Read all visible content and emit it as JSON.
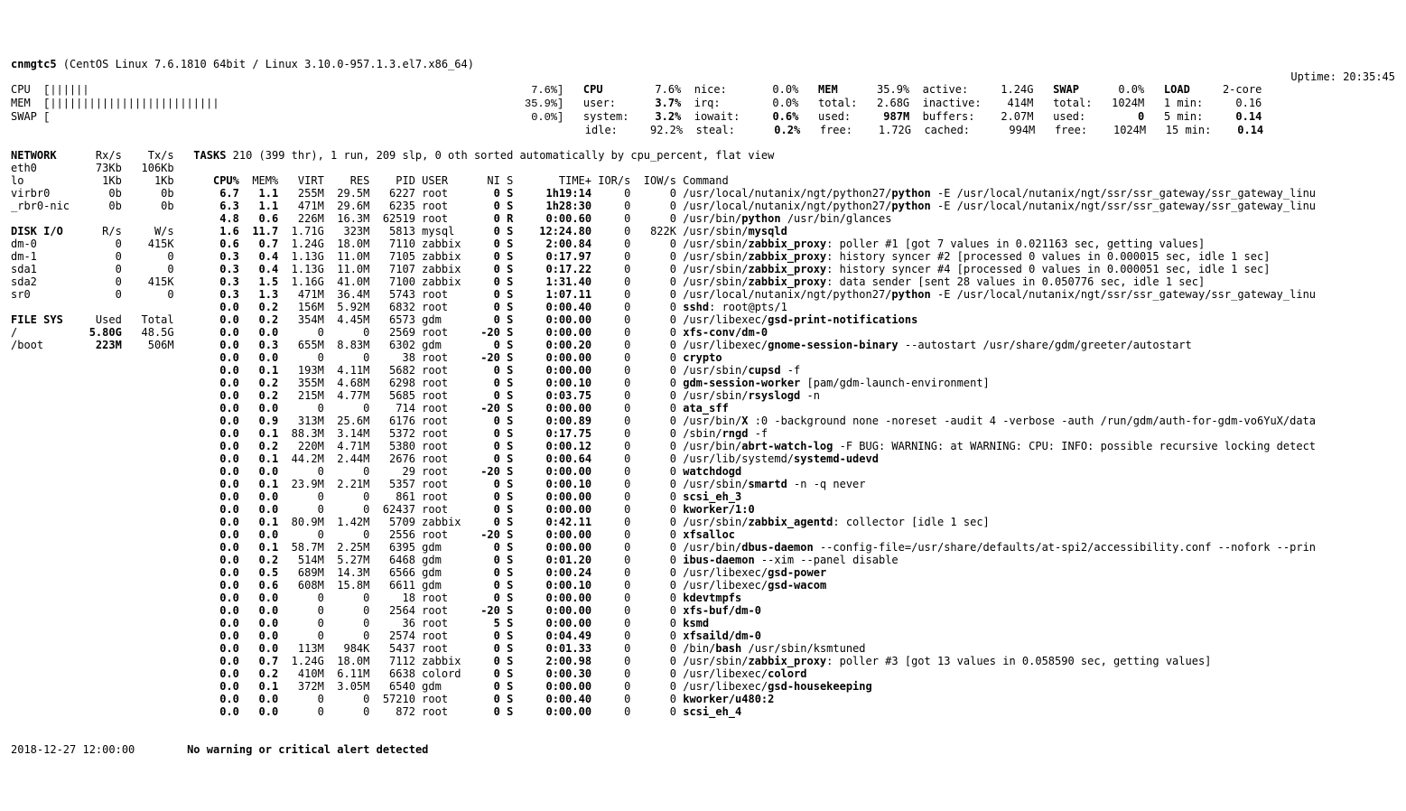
{
  "header": {
    "hostname": "cnmgtc5",
    "os": "(CentOS Linux 7.6.1810 64bit / Linux 3.10.0-957.1.3.el7.x86_64)",
    "uptime_label": "Uptime:",
    "uptime": "20:35:45"
  },
  "quicklook": {
    "cpu_label": "CPU",
    "cpu_bar": "[||||||                                                                    7.6%]",
    "mem_label": "MEM",
    "mem_bar": "[||||||||||||||||||||||||||                                               35.9%]",
    "swap_label": "SWAP",
    "swap_bar": "[                                                                          0.0%]"
  },
  "cpu": {
    "title": "CPU",
    "total": "7.6%",
    "user_label": "user:",
    "user": "3.7%",
    "system_label": "system:",
    "system": "3.2%",
    "idle_label": "idle:",
    "idle": "92.2%",
    "nice_label": "nice:",
    "nice": "0.0%",
    "irq_label": "irq:",
    "irq": "0.0%",
    "iowait_label": "iowait:",
    "iowait": "0.6%",
    "steal_label": "steal:",
    "steal": "0.2%"
  },
  "mem": {
    "title": "MEM",
    "total_pct": "35.9%",
    "total_label": "total:",
    "total": "2.68G",
    "used_label": "used:",
    "used": "987M",
    "free_label": "free:",
    "free": "1.72G",
    "active_label": "active:",
    "active": "1.24G",
    "inactive_label": "inactive:",
    "inactive": "414M",
    "buffers_label": "buffers:",
    "buffers": "2.07M",
    "cached_label": "cached:",
    "cached": "994M"
  },
  "swap": {
    "title": "SWAP",
    "pct": "0.0%",
    "total_label": "total:",
    "total": "1024M",
    "used_label": "used:",
    "used": "0",
    "free_label": "free:",
    "free": "1024M"
  },
  "load": {
    "title": "LOAD",
    "core": "2-core",
    "min1_label": "1 min:",
    "min1": "0.16",
    "min5_label": "5 min:",
    "min5": "0.14",
    "min15_label": "15 min:",
    "min15": "0.14"
  },
  "network": {
    "title": "NETWORK",
    "rx_hdr": "Rx/s",
    "tx_hdr": "Tx/s",
    "rows": [
      {
        "if": "eth0",
        "rx": "73Kb",
        "tx": "106Kb"
      },
      {
        "if": "lo",
        "rx": "1Kb",
        "tx": "1Kb"
      },
      {
        "if": "virbr0",
        "rx": "0b",
        "tx": "0b"
      },
      {
        "if": "_rbr0-nic",
        "rx": "0b",
        "tx": "0b"
      }
    ]
  },
  "diskio": {
    "title": "DISK I/O",
    "r_hdr": "R/s",
    "w_hdr": "W/s",
    "rows": [
      {
        "d": "dm-0",
        "r": "0",
        "w": "415K"
      },
      {
        "d": "dm-1",
        "r": "0",
        "w": "0"
      },
      {
        "d": "sda1",
        "r": "0",
        "w": "0"
      },
      {
        "d": "sda2",
        "r": "0",
        "w": "415K"
      },
      {
        "d": "sr0",
        "r": "0",
        "w": "0"
      }
    ]
  },
  "fs": {
    "title": "FILE SYS",
    "used_hdr": "Used",
    "total_hdr": "Total",
    "rows": [
      {
        "m": "/",
        "used": "5.80G",
        "total": "48.5G"
      },
      {
        "m": "/boot",
        "used": "223M",
        "total": "506M"
      }
    ]
  },
  "tasks": {
    "summary": [
      "TASKS",
      " 210 (399 thr), 1 run, 209 slp, 0 oth sorted automatically by cpu_percent, flat view"
    ],
    "hdr": {
      "cpu": "CPU%",
      "mem": "MEM%",
      "virt": "VIRT",
      "res": "RES",
      "pid": "PID",
      "user": "USER",
      "ni": "NI",
      "s": "S",
      "time": "TIME+",
      "ior": "IOR/s",
      "iow": "IOW/s",
      "cmd": "Command"
    },
    "rows": [
      {
        "cpu": "6.7",
        "mem": "1.1",
        "virt": "255M",
        "res": "29.5M",
        "pid": "6227",
        "user": "root",
        "ni": "0",
        "s": "S",
        "time": "1h19:14",
        "ior": "0",
        "iow": "0",
        "cmd": [
          "/usr/local/nutanix/ngt/python27/",
          "python",
          " -E /usr/local/nutanix/ngt/ssr/ssr_gateway/ssr_gateway_linu"
        ]
      },
      {
        "cpu": "6.3",
        "mem": "1.1",
        "virt": "471M",
        "res": "29.6M",
        "pid": "6235",
        "user": "root",
        "ni": "0",
        "s": "S",
        "time": "1h28:30",
        "ior": "0",
        "iow": "0",
        "cmd": [
          "/usr/local/nutanix/ngt/python27/",
          "python",
          " -E /usr/local/nutanix/ngt/ssr/ssr_gateway/ssr_gateway_linu"
        ]
      },
      {
        "cpu": "4.8",
        "mem": "0.6",
        "virt": "226M",
        "res": "16.3M",
        "pid": "62519",
        "user": "root",
        "ni": "0",
        "s": "R",
        "time": "0:00.60",
        "ior": "0",
        "iow": "0",
        "cmd": [
          "/usr/bin/",
          "python",
          " /usr/bin/glances"
        ]
      },
      {
        "cpu": "1.6",
        "mem": "11.7",
        "virt": "1.71G",
        "res": "323M",
        "pid": "5813",
        "user": "mysql",
        "ni": "0",
        "s": "S",
        "time": "12:24.80",
        "ior": "0",
        "iow": "822K",
        "cmd": [
          "/usr/sbin/",
          "mysqld",
          ""
        ]
      },
      {
        "cpu": "0.6",
        "mem": "0.7",
        "virt": "1.24G",
        "res": "18.0M",
        "pid": "7110",
        "user": "zabbix",
        "ni": "0",
        "s": "S",
        "time": "2:00.84",
        "ior": "0",
        "iow": "0",
        "cmd": [
          "/usr/sbin/",
          "zabbix_proxy",
          ": poller #1 [got 7 values in 0.021163 sec, getting values]"
        ]
      },
      {
        "cpu": "0.3",
        "mem": "0.4",
        "virt": "1.13G",
        "res": "11.0M",
        "pid": "7105",
        "user": "zabbix",
        "ni": "0",
        "s": "S",
        "time": "0:17.97",
        "ior": "0",
        "iow": "0",
        "cmd": [
          "/usr/sbin/",
          "zabbix_proxy",
          ": history syncer #2 [processed 0 values in 0.000015 sec, idle 1 sec]"
        ]
      },
      {
        "cpu": "0.3",
        "mem": "0.4",
        "virt": "1.13G",
        "res": "11.0M",
        "pid": "7107",
        "user": "zabbix",
        "ni": "0",
        "s": "S",
        "time": "0:17.22",
        "ior": "0",
        "iow": "0",
        "cmd": [
          "/usr/sbin/",
          "zabbix_proxy",
          ": history syncer #4 [processed 0 values in 0.000051 sec, idle 1 sec]"
        ]
      },
      {
        "cpu": "0.3",
        "mem": "1.5",
        "virt": "1.16G",
        "res": "41.0M",
        "pid": "7100",
        "user": "zabbix",
        "ni": "0",
        "s": "S",
        "time": "1:31.40",
        "ior": "0",
        "iow": "0",
        "cmd": [
          "/usr/sbin/",
          "zabbix_proxy",
          ": data sender [sent 28 values in 0.050776 sec, idle 1 sec]"
        ]
      },
      {
        "cpu": "0.3",
        "mem": "1.3",
        "virt": "471M",
        "res": "36.4M",
        "pid": "5743",
        "user": "root",
        "ni": "0",
        "s": "S",
        "time": "1:07.11",
        "ior": "0",
        "iow": "0",
        "cmd": [
          "/usr/local/nutanix/ngt/python27/",
          "python",
          " -E /usr/local/nutanix/ngt/ssr/ssr_gateway/ssr_gateway_linu"
        ]
      },
      {
        "cpu": "0.0",
        "mem": "0.2",
        "virt": "156M",
        "res": "5.92M",
        "pid": "6832",
        "user": "root",
        "ni": "0",
        "s": "S",
        "time": "0:00.40",
        "ior": "0",
        "iow": "0",
        "cmd": [
          "",
          "sshd",
          ": root@pts/1"
        ]
      },
      {
        "cpu": "0.0",
        "mem": "0.2",
        "virt": "354M",
        "res": "4.45M",
        "pid": "6573",
        "user": "gdm",
        "ni": "0",
        "s": "S",
        "time": "0:00.00",
        "ior": "0",
        "iow": "0",
        "cmd": [
          "/usr/libexec/",
          "gsd-print-notifications",
          ""
        ]
      },
      {
        "cpu": "0.0",
        "mem": "0.0",
        "virt": "0",
        "res": "0",
        "pid": "2569",
        "user": "root",
        "ni": "-20",
        "s": "S",
        "time": "0:00.00",
        "ior": "0",
        "iow": "0",
        "cmd": [
          "",
          "xfs-conv/dm-0",
          ""
        ]
      },
      {
        "cpu": "0.0",
        "mem": "0.3",
        "virt": "655M",
        "res": "8.83M",
        "pid": "6302",
        "user": "gdm",
        "ni": "0",
        "s": "S",
        "time": "0:00.20",
        "ior": "0",
        "iow": "0",
        "cmd": [
          "/usr/libexec/",
          "gnome-session-binary",
          " --autostart /usr/share/gdm/greeter/autostart"
        ]
      },
      {
        "cpu": "0.0",
        "mem": "0.0",
        "virt": "0",
        "res": "0",
        "pid": "38",
        "user": "root",
        "ni": "-20",
        "s": "S",
        "time": "0:00.00",
        "ior": "0",
        "iow": "0",
        "cmd": [
          "",
          "crypto",
          ""
        ]
      },
      {
        "cpu": "0.0",
        "mem": "0.1",
        "virt": "193M",
        "res": "4.11M",
        "pid": "5682",
        "user": "root",
        "ni": "0",
        "s": "S",
        "time": "0:00.00",
        "ior": "0",
        "iow": "0",
        "cmd": [
          "/usr/sbin/",
          "cupsd",
          " -f"
        ]
      },
      {
        "cpu": "0.0",
        "mem": "0.2",
        "virt": "355M",
        "res": "4.68M",
        "pid": "6298",
        "user": "root",
        "ni": "0",
        "s": "S",
        "time": "0:00.10",
        "ior": "0",
        "iow": "0",
        "cmd": [
          "",
          "gdm-session-worker",
          " [pam/gdm-launch-environment]"
        ]
      },
      {
        "cpu": "0.0",
        "mem": "0.2",
        "virt": "215M",
        "res": "4.77M",
        "pid": "5685",
        "user": "root",
        "ni": "0",
        "s": "S",
        "time": "0:03.75",
        "ior": "0",
        "iow": "0",
        "cmd": [
          "/usr/sbin/",
          "rsyslogd",
          " -n"
        ]
      },
      {
        "cpu": "0.0",
        "mem": "0.0",
        "virt": "0",
        "res": "0",
        "pid": "714",
        "user": "root",
        "ni": "-20",
        "s": "S",
        "time": "0:00.00",
        "ior": "0",
        "iow": "0",
        "cmd": [
          "",
          "ata_sff",
          ""
        ]
      },
      {
        "cpu": "0.0",
        "mem": "0.9",
        "virt": "313M",
        "res": "25.6M",
        "pid": "6176",
        "user": "root",
        "ni": "0",
        "s": "S",
        "time": "0:00.89",
        "ior": "0",
        "iow": "0",
        "cmd": [
          "/usr/bin/",
          "X",
          " :0 -background none -noreset -audit 4 -verbose -auth /run/gdm/auth-for-gdm-vo6YuX/data"
        ]
      },
      {
        "cpu": "0.0",
        "mem": "0.1",
        "virt": "88.3M",
        "res": "3.14M",
        "pid": "5372",
        "user": "root",
        "ni": "0",
        "s": "S",
        "time": "0:17.75",
        "ior": "0",
        "iow": "0",
        "cmd": [
          "/sbin/",
          "rngd",
          " -f"
        ]
      },
      {
        "cpu": "0.0",
        "mem": "0.2",
        "virt": "220M",
        "res": "4.71M",
        "pid": "5380",
        "user": "root",
        "ni": "0",
        "s": "S",
        "time": "0:00.12",
        "ior": "0",
        "iow": "0",
        "cmd": [
          "/usr/bin/",
          "abrt-watch-log",
          " -F BUG: WARNING: at WARNING: CPU: INFO: possible recursive locking detect"
        ]
      },
      {
        "cpu": "0.0",
        "mem": "0.1",
        "virt": "44.2M",
        "res": "2.44M",
        "pid": "2676",
        "user": "root",
        "ni": "0",
        "s": "S",
        "time": "0:00.64",
        "ior": "0",
        "iow": "0",
        "cmd": [
          "/usr/lib/systemd/",
          "systemd-udevd",
          ""
        ]
      },
      {
        "cpu": "0.0",
        "mem": "0.0",
        "virt": "0",
        "res": "0",
        "pid": "29",
        "user": "root",
        "ni": "-20",
        "s": "S",
        "time": "0:00.00",
        "ior": "0",
        "iow": "0",
        "cmd": [
          "",
          "watchdogd",
          ""
        ]
      },
      {
        "cpu": "0.0",
        "mem": "0.1",
        "virt": "23.9M",
        "res": "2.21M",
        "pid": "5357",
        "user": "root",
        "ni": "0",
        "s": "S",
        "time": "0:00.10",
        "ior": "0",
        "iow": "0",
        "cmd": [
          "/usr/sbin/",
          "smartd",
          " -n -q never"
        ]
      },
      {
        "cpu": "0.0",
        "mem": "0.0",
        "virt": "0",
        "res": "0",
        "pid": "861",
        "user": "root",
        "ni": "0",
        "s": "S",
        "time": "0:00.00",
        "ior": "0",
        "iow": "0",
        "cmd": [
          "",
          "scsi_eh_3",
          ""
        ]
      },
      {
        "cpu": "0.0",
        "mem": "0.0",
        "virt": "0",
        "res": "0",
        "pid": "62437",
        "user": "root",
        "ni": "0",
        "s": "S",
        "time": "0:00.00",
        "ior": "0",
        "iow": "0",
        "cmd": [
          "",
          "kworker/1:0",
          ""
        ]
      },
      {
        "cpu": "0.0",
        "mem": "0.1",
        "virt": "80.9M",
        "res": "1.42M",
        "pid": "5709",
        "user": "zabbix",
        "ni": "0",
        "s": "S",
        "time": "0:42.11",
        "ior": "0",
        "iow": "0",
        "cmd": [
          "/usr/sbin/",
          "zabbix_agentd",
          ": collector [idle 1 sec]"
        ]
      },
      {
        "cpu": "0.0",
        "mem": "0.0",
        "virt": "0",
        "res": "0",
        "pid": "2556",
        "user": "root",
        "ni": "-20",
        "s": "S",
        "time": "0:00.00",
        "ior": "0",
        "iow": "0",
        "cmd": [
          "",
          "xfsalloc",
          ""
        ]
      },
      {
        "cpu": "0.0",
        "mem": "0.1",
        "virt": "58.7M",
        "res": "2.25M",
        "pid": "6395",
        "user": "gdm",
        "ni": "0",
        "s": "S",
        "time": "0:00.00",
        "ior": "0",
        "iow": "0",
        "cmd": [
          "/usr/bin/",
          "dbus-daemon",
          " --config-file=/usr/share/defaults/at-spi2/accessibility.conf --nofork --prin"
        ]
      },
      {
        "cpu": "0.0",
        "mem": "0.2",
        "virt": "514M",
        "res": "5.27M",
        "pid": "6468",
        "user": "gdm",
        "ni": "0",
        "s": "S",
        "time": "0:01.20",
        "ior": "0",
        "iow": "0",
        "cmd": [
          "",
          "ibus-daemon",
          " --xim --panel disable"
        ]
      },
      {
        "cpu": "0.0",
        "mem": "0.5",
        "virt": "689M",
        "res": "14.3M",
        "pid": "6566",
        "user": "gdm",
        "ni": "0",
        "s": "S",
        "time": "0:00.24",
        "ior": "0",
        "iow": "0",
        "cmd": [
          "/usr/libexec/",
          "gsd-power",
          ""
        ]
      },
      {
        "cpu": "0.0",
        "mem": "0.6",
        "virt": "608M",
        "res": "15.8M",
        "pid": "6611",
        "user": "gdm",
        "ni": "0",
        "s": "S",
        "time": "0:00.10",
        "ior": "0",
        "iow": "0",
        "cmd": [
          "/usr/libexec/",
          "gsd-wacom",
          ""
        ]
      },
      {
        "cpu": "0.0",
        "mem": "0.0",
        "virt": "0",
        "res": "0",
        "pid": "18",
        "user": "root",
        "ni": "0",
        "s": "S",
        "time": "0:00.00",
        "ior": "0",
        "iow": "0",
        "cmd": [
          "",
          "kdevtmpfs",
          ""
        ]
      },
      {
        "cpu": "0.0",
        "mem": "0.0",
        "virt": "0",
        "res": "0",
        "pid": "2564",
        "user": "root",
        "ni": "-20",
        "s": "S",
        "time": "0:00.00",
        "ior": "0",
        "iow": "0",
        "cmd": [
          "",
          "xfs-buf/dm-0",
          ""
        ]
      },
      {
        "cpu": "0.0",
        "mem": "0.0",
        "virt": "0",
        "res": "0",
        "pid": "36",
        "user": "root",
        "ni": "5",
        "s": "S",
        "time": "0:00.00",
        "ior": "0",
        "iow": "0",
        "cmd": [
          "",
          "ksmd",
          ""
        ]
      },
      {
        "cpu": "0.0",
        "mem": "0.0",
        "virt": "0",
        "res": "0",
        "pid": "2574",
        "user": "root",
        "ni": "0",
        "s": "S",
        "time": "0:04.49",
        "ior": "0",
        "iow": "0",
        "cmd": [
          "",
          "xfsaild/dm-0",
          ""
        ]
      },
      {
        "cpu": "0.0",
        "mem": "0.0",
        "virt": "113M",
        "res": "984K",
        "pid": "5437",
        "user": "root",
        "ni": "0",
        "s": "S",
        "time": "0:01.33",
        "ior": "0",
        "iow": "0",
        "cmd": [
          "/bin/",
          "bash",
          " /usr/sbin/ksmtuned"
        ]
      },
      {
        "cpu": "0.0",
        "mem": "0.7",
        "virt": "1.24G",
        "res": "18.0M",
        "pid": "7112",
        "user": "zabbix",
        "ni": "0",
        "s": "S",
        "time": "2:00.98",
        "ior": "0",
        "iow": "0",
        "cmd": [
          "/usr/sbin/",
          "zabbix_proxy",
          ": poller #3 [got 13 values in 0.058590 sec, getting values]"
        ]
      },
      {
        "cpu": "0.0",
        "mem": "0.2",
        "virt": "410M",
        "res": "6.11M",
        "pid": "6638",
        "user": "colord",
        "ni": "0",
        "s": "S",
        "time": "0:00.30",
        "ior": "0",
        "iow": "0",
        "cmd": [
          "/usr/libexec/",
          "colord",
          ""
        ]
      },
      {
        "cpu": "0.0",
        "mem": "0.1",
        "virt": "372M",
        "res": "3.05M",
        "pid": "6540",
        "user": "gdm",
        "ni": "0",
        "s": "S",
        "time": "0:00.00",
        "ior": "0",
        "iow": "0",
        "cmd": [
          "/usr/libexec/",
          "gsd-housekeeping",
          ""
        ]
      },
      {
        "cpu": "0.0",
        "mem": "0.0",
        "virt": "0",
        "res": "0",
        "pid": "57210",
        "user": "root",
        "ni": "0",
        "s": "S",
        "time": "0:00.40",
        "ior": "0",
        "iow": "0",
        "cmd": [
          "",
          "kworker/u480:2",
          ""
        ]
      },
      {
        "cpu": "0.0",
        "mem": "0.0",
        "virt": "0",
        "res": "0",
        "pid": "872",
        "user": "root",
        "ni": "0",
        "s": "S",
        "time": "0:00.00",
        "ior": "0",
        "iow": "0",
        "cmd": [
          "",
          "scsi_eh_4",
          ""
        ]
      }
    ]
  },
  "footer": {
    "datetime": "2018-12-27 12:00:00",
    "alert": "No warning or critical alert detected"
  }
}
